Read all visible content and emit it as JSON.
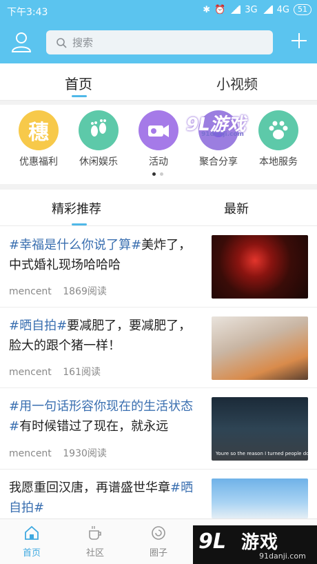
{
  "status_bar": {
    "time": "下午3:43",
    "network1": "3G",
    "network2": "4G",
    "battery": "51"
  },
  "search": {
    "placeholder": "搜索"
  },
  "main_tabs": [
    {
      "label": "首页"
    },
    {
      "label": "小视频"
    }
  ],
  "categories": [
    {
      "label": "优惠福利",
      "icon": "穗",
      "color": "#f7c94a"
    },
    {
      "label": "休闲娱乐",
      "icon": "footprints-icon",
      "color": "#5dc9a9"
    },
    {
      "label": "活动",
      "icon": "camera-icon",
      "color": "#a57ae8"
    },
    {
      "label": "聚合分享",
      "icon": "share-icon",
      "color": "#9b7ee0"
    },
    {
      "label": "本地服务",
      "icon": "paw-icon",
      "color": "#5dc9a9"
    }
  ],
  "feed_tabs": [
    {
      "label": "精彩推荐"
    },
    {
      "label": "最新"
    }
  ],
  "feed": [
    {
      "title": "#幸福是什么你说了算#美炸了，中式婚礼现场哈哈哈",
      "author": "mencent",
      "reads": "1869阅读"
    },
    {
      "title": "#晒自拍#要减肥了，要减肥了，脸大的跟个猪一样！",
      "author": "mencent",
      "reads": "161阅读"
    },
    {
      "title": "#用一句话形容你现在的生活状态#有时候错过了现在，就永远",
      "author": "mencent",
      "reads": "1930阅读",
      "thumb_caption": "Youre so the reason I turned people down"
    },
    {
      "title": "我愿重回汉唐，再谱盛世华章#晒自拍#",
      "author": "",
      "reads": ""
    }
  ],
  "bottom_nav": [
    {
      "label": "首页"
    },
    {
      "label": "社区"
    },
    {
      "label": "圈子"
    }
  ],
  "watermark": {
    "top_text": "9L游戏",
    "top_small": "91danji.com",
    "bottom_big": "游戏",
    "bottom_logo": "9L",
    "bottom_small": "91danji.com"
  },
  "colors": {
    "accent": "#5bc4ef",
    "hashtag": "#3a6fb0"
  }
}
